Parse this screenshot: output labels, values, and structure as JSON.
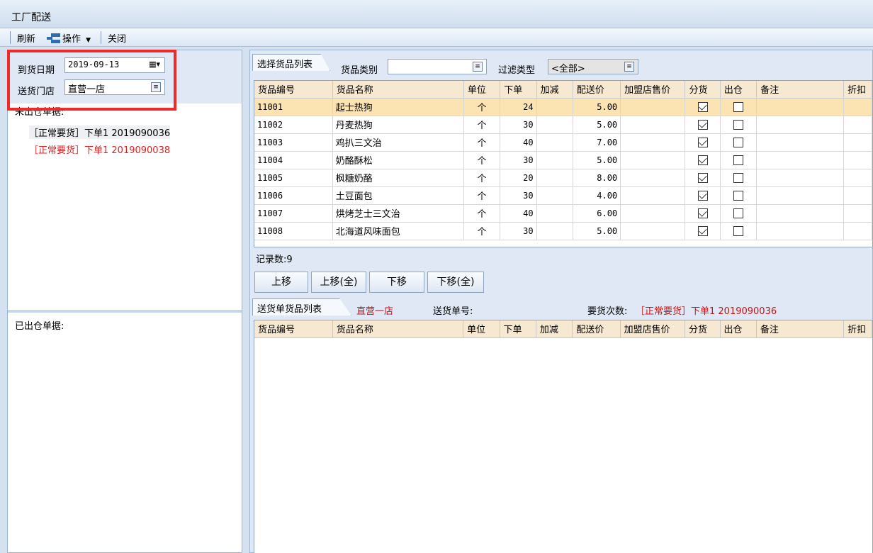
{
  "window": {
    "title": "工厂配送"
  },
  "toolbar": {
    "refresh": "刷新",
    "operate": "操作",
    "close": "关闭"
  },
  "filters": {
    "arrival_date_label": "到货日期",
    "arrival_date_value": "2019-09-13",
    "store_label": "送货门店",
    "store_value": "直营一店"
  },
  "unshipped": {
    "title": "未出仓单据:",
    "orders": [
      {
        "text": "［正常要货］下单1 2019090036"
      },
      {
        "text": "［正常要货］下单1 2019090038"
      }
    ]
  },
  "shipped": {
    "title": "已出仓单据:"
  },
  "goods_select": {
    "tab_label": "选择货品列表",
    "category_label": "货品类别",
    "category_value": "",
    "filter_type_label": "过滤类型",
    "filter_type_value": "<全部>",
    "columns": [
      "货品编号",
      "货品名称",
      "单位",
      "下单",
      "加减",
      "配送价",
      "加盟店售价",
      "分货",
      "出仓",
      "备注",
      "折扣"
    ],
    "rows": [
      {
        "code": "11001",
        "name": "起士热狗",
        "unit": "个",
        "qty": "24",
        "adj": "",
        "price": "5.00",
        "fprice": "",
        "split": true,
        "out": false,
        "note": "",
        "disc": ""
      },
      {
        "code": "11002",
        "name": "丹麦热狗",
        "unit": "个",
        "qty": "30",
        "adj": "",
        "price": "5.00",
        "fprice": "",
        "split": true,
        "out": false,
        "note": "",
        "disc": ""
      },
      {
        "code": "11003",
        "name": "鸡扒三文治",
        "unit": "个",
        "qty": "40",
        "adj": "",
        "price": "7.00",
        "fprice": "",
        "split": true,
        "out": false,
        "note": "",
        "disc": ""
      },
      {
        "code": "11004",
        "name": "奶酪酥松",
        "unit": "个",
        "qty": "30",
        "adj": "",
        "price": "5.00",
        "fprice": "",
        "split": true,
        "out": false,
        "note": "",
        "disc": ""
      },
      {
        "code": "11005",
        "name": "枫糖奶酪",
        "unit": "个",
        "qty": "20",
        "adj": "",
        "price": "8.00",
        "fprice": "",
        "split": true,
        "out": false,
        "note": "",
        "disc": ""
      },
      {
        "code": "11006",
        "name": "土豆面包",
        "unit": "个",
        "qty": "30",
        "adj": "",
        "price": "4.00",
        "fprice": "",
        "split": true,
        "out": false,
        "note": "",
        "disc": ""
      },
      {
        "code": "11007",
        "name": "烘烤芝士三文治",
        "unit": "个",
        "qty": "40",
        "adj": "",
        "price": "6.00",
        "fprice": "",
        "split": true,
        "out": false,
        "note": "",
        "disc": ""
      },
      {
        "code": "11008",
        "name": "北海道风味面包",
        "unit": "个",
        "qty": "30",
        "adj": "",
        "price": "5.00",
        "fprice": "",
        "split": true,
        "out": false,
        "note": "",
        "disc": ""
      }
    ],
    "record_count": "记录数:9"
  },
  "move_buttons": {
    "up": "上移",
    "up_all": "上移(全)",
    "down": "下移",
    "down_all": "下移(全)"
  },
  "delivery": {
    "tab_label": "送货单货品列表",
    "store": "直营一店",
    "order_no_label": "送货单号:",
    "order_count_label": "要货次数:",
    "order_count_value": "［正常要货］下单1 2019090036",
    "columns": [
      "货品编号",
      "货品名称",
      "单位",
      "下单",
      "加减",
      "配送价",
      "加盟店售价",
      "分货",
      "出仓",
      "备注",
      "折扣"
    ]
  },
  "colors": {
    "accent_red": "#ee2b2b",
    "row_selected": "#fbe3b2",
    "header_bg": "#f7e8d2"
  }
}
